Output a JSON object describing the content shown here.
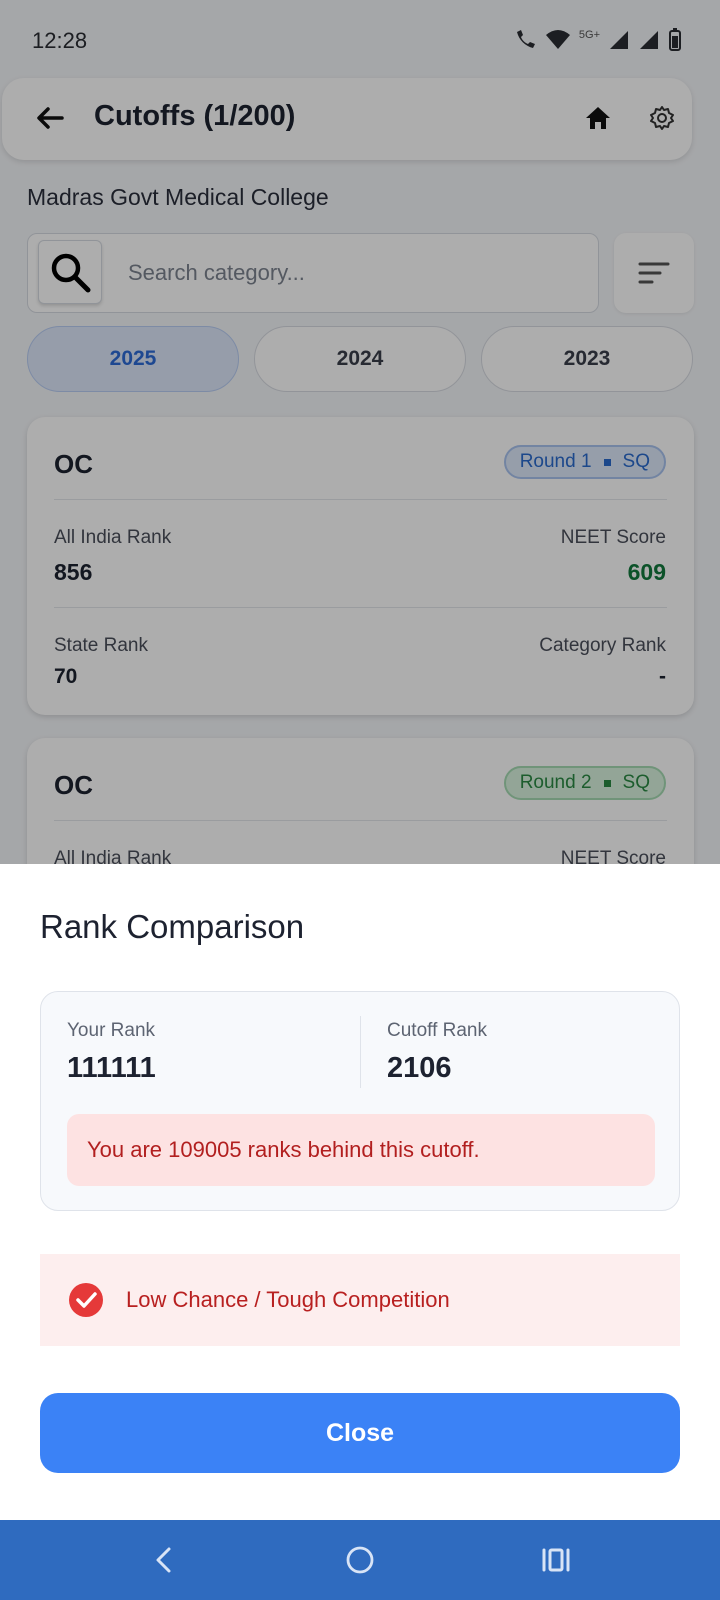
{
  "status_bar": {
    "time": "12:28",
    "network": "5G+"
  },
  "app_bar": {
    "title": "Cutoffs (1/200)"
  },
  "college": {
    "name": "Madras Govt Medical College"
  },
  "search": {
    "placeholder": "Search category..."
  },
  "year_tabs": [
    {
      "label": "2025",
      "active": true
    },
    {
      "label": "2024",
      "active": false
    },
    {
      "label": "2023",
      "active": false
    }
  ],
  "cards": [
    {
      "category": "OC",
      "round": "Round 1",
      "quota": "SQ",
      "badge_color": "blue",
      "air_label": "All India Rank",
      "air_value": "856",
      "neet_label": "NEET Score",
      "neet_value": "609",
      "state_label": "State Rank",
      "state_value": "70",
      "cat_label": "Category Rank",
      "cat_value": "-"
    },
    {
      "category": "OC",
      "round": "Round 2",
      "quota": "SQ",
      "badge_color": "green",
      "air_label": "All India Rank",
      "neet_label": "NEET Score"
    }
  ],
  "sheet": {
    "title": "Rank Comparison",
    "your_rank_label": "Your Rank",
    "your_rank_value": "111111",
    "cutoff_rank_label": "Cutoff Rank",
    "cutoff_rank_value": "2106",
    "behind_message": "You are 109005 ranks behind this cutoff.",
    "chance_text": "Low Chance / Tough Competition",
    "close_label": "Close"
  },
  "colors": {
    "primary": "#3b82f6",
    "danger": "#b82020",
    "success": "#137a3d",
    "nav_bar": "#2f6bbf"
  }
}
